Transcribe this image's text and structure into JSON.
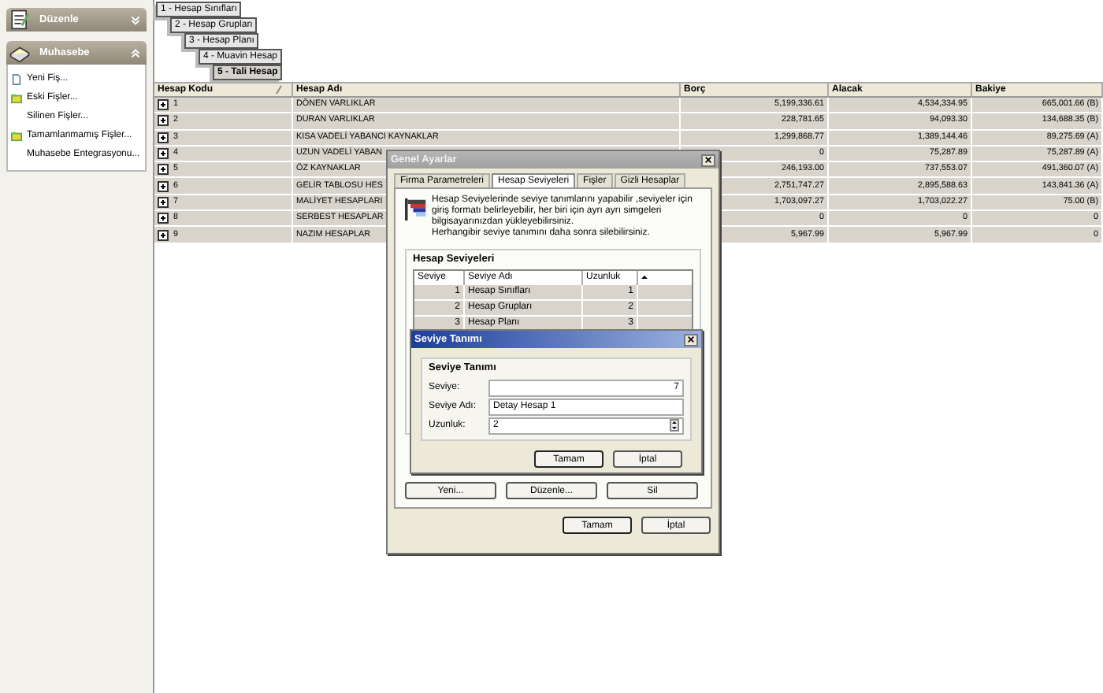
{
  "sidebar": {
    "panels": [
      {
        "title": "Düzenle",
        "expanded": false,
        "kind": "notepad"
      },
      {
        "title": "Muhasebe",
        "expanded": true,
        "kind": "book",
        "items": [
          {
            "label": "Yeni Fiş...",
            "kind": "document"
          },
          {
            "label": "Eski Fişler...",
            "kind": "folder"
          },
          {
            "label": "Silinen Fişler..."
          },
          {
            "label": "Tamamlanmamış Fişler...",
            "kind": "folder"
          },
          {
            "label": "Muhasebe Entegrasyonu..."
          }
        ]
      }
    ]
  },
  "levels": [
    {
      "label": "1 - Hesap Sınıfları",
      "selected": false
    },
    {
      "label": "2 - Hesap Grupları",
      "selected": false
    },
    {
      "label": "3 - Hesap  Planı",
      "selected": false
    },
    {
      "label": "4 - Muavin Hesap",
      "selected": false
    },
    {
      "label": "5 - Tali Hesap",
      "selected": true
    }
  ],
  "table": {
    "columns": [
      "Hesap Kodu",
      "Hesap Adı",
      "Borç",
      "Alacak",
      "Bakiye"
    ],
    "rows": [
      {
        "code": "1",
        "name": "DÖNEN VARLIKLAR",
        "debit": "5,199,336.61",
        "credit": "4,534,334.95",
        "balance": "665,001.66 (B)"
      },
      {
        "code": "2",
        "name": "DURAN VARLIKLAR",
        "debit": "228,781.65",
        "credit": "94,093.30",
        "balance": "134,688.35 (B)"
      },
      {
        "code": "3",
        "name": "KISA VADELİ YABANCI KAYNAKLAR",
        "debit": "1,299,868.77",
        "credit": "1,389,144.46",
        "balance": "89,275.69 (A)"
      },
      {
        "code": "4",
        "name": "UZUN VADELİ YABAN",
        "debit": "0",
        "credit": "75,287.89",
        "balance": "75,287.89 (A)"
      },
      {
        "code": "5",
        "name": "ÖZ KAYNAKLAR",
        "debit": "246,193.00",
        "credit": "737,553.07",
        "balance": "491,360.07 (A)"
      },
      {
        "code": "6",
        "name": "GELİR TABLOSU HES",
        "debit": "2,751,747.27",
        "credit": "2,895,588.63",
        "balance": "143,841.36 (A)"
      },
      {
        "code": "7",
        "name": "MALİYET HESAPLARI",
        "debit": "1,703,097.27",
        "credit": "1,703,022.27",
        "balance": "75.00 (B)"
      },
      {
        "code": "8",
        "name": "SERBEST HESAPLAR",
        "debit": "0",
        "credit": "0",
        "balance": "0"
      },
      {
        "code": "9",
        "name": "NAZIM HESAPLAR",
        "debit": "5,967.99",
        "credit": "5,967.99",
        "balance": "0"
      }
    ]
  },
  "settings_dialog": {
    "title": "Genel Ayarlar",
    "active": false,
    "tabs": [
      {
        "label": "Firma Parametreleri",
        "selected": false
      },
      {
        "label": "Hesap Seviyeleri",
        "selected": true
      },
      {
        "label": "Fişler",
        "selected": false
      },
      {
        "label": "Gizli Hesaplar",
        "selected": false
      }
    ],
    "description": [
      "Hesap Seviyelerinde seviye tanımlarını yapabilir ,seviyeler için giriş formatı belirleyebilir, her biri için ayrı ayrı simgeleri bilgisayarınızdan yükleyebilirsiniz.",
      "Herhangibir seviye tanımını daha sonra silebilirsiniz."
    ],
    "group_title": "Hesap Seviyeleri",
    "columns": [
      "Seviye",
      "Seviye Adı",
      "Uzunluk"
    ],
    "rows": [
      {
        "level": "1",
        "name": "Hesap Sınıfları",
        "length": "1"
      },
      {
        "level": "2",
        "name": "Hesap Grupları",
        "length": "2"
      },
      {
        "level": "3",
        "name": "Hesap  Planı",
        "length": "3"
      }
    ],
    "row_buttons": [
      "Yeni...",
      "Düzenle...",
      "Sil"
    ],
    "buttons": [
      "Tamam",
      "İptal"
    ]
  },
  "level_dialog": {
    "title": "Seviye Tanımı",
    "active": true,
    "group_title": "Seviye Tanımı",
    "fields": [
      {
        "label": "Seviye:",
        "value": "7",
        "kind": "number"
      },
      {
        "label": "Seviye Adı:",
        "value": "Detay Hesap 1",
        "kind": "text"
      },
      {
        "label": "Uzunluk:",
        "value": "2",
        "kind": "spinner"
      }
    ],
    "buttons": [
      "Tamam",
      "İptal"
    ]
  }
}
